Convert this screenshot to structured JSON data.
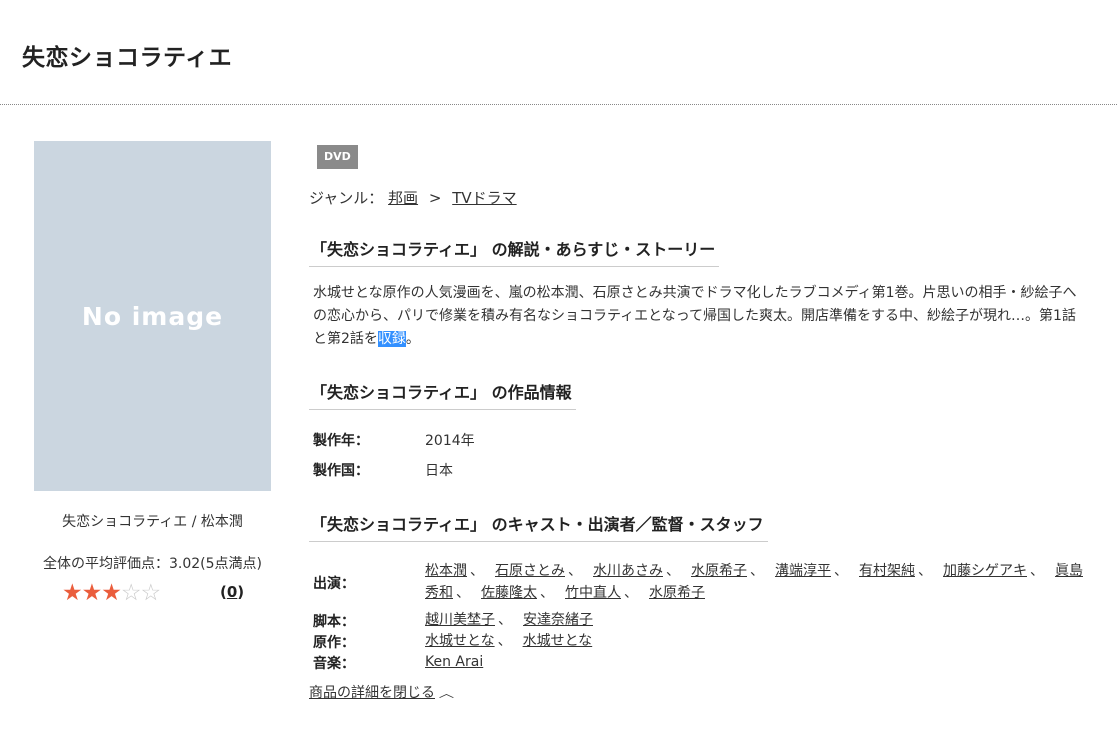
{
  "page": {
    "title": "失恋ショコラティエ"
  },
  "product": {
    "image_text": "No image",
    "caption": "失恋ショコラティエ / 松本潤",
    "avg_rating_text": "全体の平均評価点：3.02(5点満点)",
    "rating": 3.02,
    "rating_max": 5,
    "stars": {
      "full": "★★★",
      "empty": "☆☆"
    },
    "review_count_open": "(",
    "review_count": "0",
    "review_count_close": ")"
  },
  "format_badge": "DVD",
  "genre": {
    "label": "ジャンル：",
    "parent": "邦画",
    "separator": ">",
    "child": "TVドラマ"
  },
  "sections": {
    "story_heading": "「失恋ショコラティエ」 の解説・あらすじ・ストーリー",
    "info_heading": "「失恋ショコラティエ」 の作品情報",
    "cast_heading": "「失恋ショコラティエ」 のキャスト・出演者／監督・スタッフ"
  },
  "description": {
    "text_before": "水城せとな原作の人気漫画を、嵐の松本潤、石原さとみ共演でドラマ化したラブコメディ第1巻。片思いの相手・紗絵子への恋心から、パリで修業を積み有名なショコラティエとなって帰国した爽太。開店準備をする中、紗絵子が現れ…。第1話と第2話を",
    "highlighted": "収録",
    "text_after": "。"
  },
  "info": {
    "year_label": "製作年：",
    "year_value": "2014年",
    "country_label": "製作国：",
    "country_value": "日本"
  },
  "cast": {
    "performers_label": "出演：",
    "performers": [
      "松本潤",
      "石原さとみ",
      "水川あさみ",
      "水原希子",
      "溝端淳平",
      "有村架純",
      "加藤シゲアキ",
      "眞島秀和",
      "佐藤隆太",
      "竹中直人",
      "水原希子"
    ],
    "writer_label": "脚本：",
    "writers": [
      "越川美埜子",
      "安達奈緒子"
    ],
    "original_label": "原作：",
    "originals": [
      "水城せとな",
      "水城せとな"
    ],
    "music_label": "音楽：",
    "music": [
      "Ken Arai"
    ],
    "separator": "、"
  },
  "close_link": "商品の詳細を閉じる",
  "close_icon": "chevron-up-icon",
  "colors": {
    "star": "#ea5d3c",
    "badge": "#8a8a8a",
    "noimage_bg": "#cbd6e0",
    "highlight": "#3390ff"
  }
}
